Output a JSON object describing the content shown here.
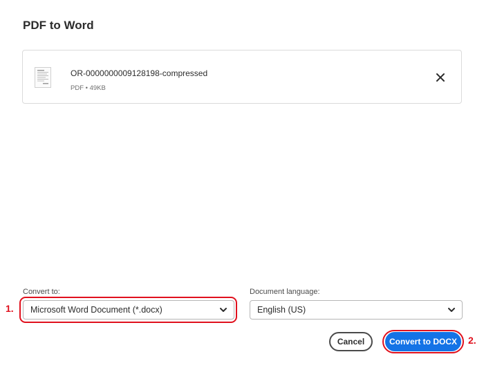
{
  "dialog": {
    "title": "PDF to Word"
  },
  "file": {
    "name": "OR-0000000009128198-compressed",
    "meta": "PDF • 49KB",
    "thumb_icon": "pdf-document-thumbnail-icon",
    "remove_icon": "close-icon"
  },
  "convert_to": {
    "label": "Convert to:",
    "value": "Microsoft Word Document (*.docx)",
    "icon": "chevron-down-icon"
  },
  "document_language": {
    "label": "Document language:",
    "value": "English (US)",
    "icon": "chevron-down-icon"
  },
  "actions": {
    "cancel_label": "Cancel",
    "convert_label": "Convert to DOCX"
  },
  "annotations": {
    "step1": "1.",
    "step2": "2.",
    "color": "#e0101d"
  },
  "colors": {
    "primary": "#1473e6",
    "text": "#2c2c2c",
    "border": "#dadada"
  }
}
